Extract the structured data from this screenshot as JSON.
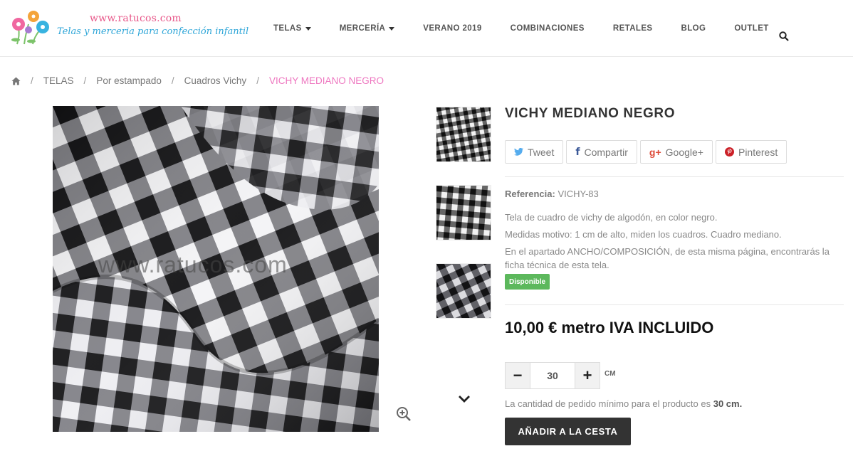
{
  "header": {
    "logo_url_text": "www.ratucos.com",
    "logo_tagline": "Telas y merceria para confección infantil",
    "nav": [
      {
        "label": "TELAS",
        "has_caret": true
      },
      {
        "label": "MERCERÍA",
        "has_caret": true
      },
      {
        "label": "VERANO 2019",
        "has_caret": false
      },
      {
        "label": "COMBINACIONES",
        "has_caret": false
      },
      {
        "label": "RETALES",
        "has_caret": false
      },
      {
        "label": "BLOG",
        "has_caret": false
      },
      {
        "label": "OUTLET",
        "has_caret": false
      }
    ],
    "search_icon": "search-icon"
  },
  "breadcrumb": {
    "home_icon": "home-icon",
    "items": [
      "TELAS",
      "Por estampado",
      "Cuadros Vichy"
    ],
    "current": "VICHY MEDIANO NEGRO",
    "separator": "/"
  },
  "gallery": {
    "watermark": "www.ratucos.com",
    "zoom_icon": "zoom-in-icon",
    "thumb_next_icon": "chevron-down-icon"
  },
  "product": {
    "title": "VICHY MEDIANO NEGRO",
    "social": [
      {
        "icon": "twitter-icon",
        "glyph": "🐦",
        "label": "Tweet",
        "color": "#55acee"
      },
      {
        "icon": "facebook-icon",
        "glyph": "f",
        "label": "Compartir",
        "color": "#3b5998"
      },
      {
        "icon": "google-plus-icon",
        "glyph": "g+",
        "label": "Google+",
        "color": "#dd4b39"
      },
      {
        "icon": "pinterest-icon",
        "glyph": "P",
        "label": "Pinterest",
        "color": "#cb2027"
      }
    ],
    "reference_label": "Referencia:",
    "reference_value": "VICHY-83",
    "description": [
      "Tela de cuadro de vichy de algodón, en color negro.",
      "Medidas motivo: 1 cm de alto, miden los cuadros. Cuadro mediano.",
      "En el apartado ANCHO/COMPOSICIÓN, de esta misma página, encontrarás la ficha técnica de esta tela."
    ],
    "availability": "Disponible",
    "availability_color": "#5cb85c",
    "price": "10,00 € metro IVA INCLUIDO",
    "quantity": {
      "minus": "−",
      "plus": "+",
      "value": "30",
      "unit": "CM"
    },
    "min_note_prefix": "La cantidad de pedido mínimo para el producto es",
    "min_note_value": "30 cm.",
    "add_to_cart": "AÑADIR A LA CESTA"
  }
}
